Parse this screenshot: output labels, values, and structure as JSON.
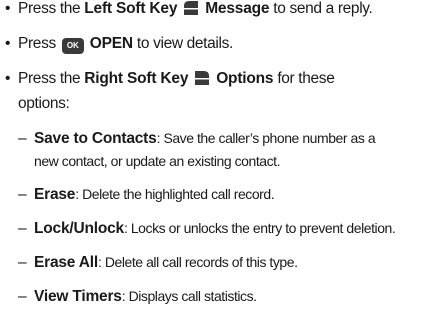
{
  "bullets": [
    {
      "prefix": "Press the ",
      "bold1": "Left Soft Key",
      "icon": "left-soft-key-icon",
      "bold2": "Message",
      "suffix": " to send a reply."
    },
    {
      "prefix": "Press ",
      "icon": "ok-key-icon",
      "icon_label": "OK",
      "bold1": "OPEN",
      "suffix": " to view details."
    },
    {
      "prefix": "Press the ",
      "bold1": "Right Soft Key",
      "icon": "right-soft-key-icon",
      "bold2": "Options",
      "suffix": " for these",
      "continuation": "options:"
    }
  ],
  "options": [
    {
      "term": "Save to Contacts",
      "desc": ": Save the caller’s phone number as a",
      "continuation": "new contact, or update an existing contact."
    },
    {
      "term": "Erase",
      "desc": ": Delete the highlighted call record."
    },
    {
      "term": "Lock/Unlock",
      "desc": ": Locks or unlocks the entry to prevent deletion."
    },
    {
      "term": "Erase All",
      "desc": ": Delete all call records of this type."
    },
    {
      "term": "View Timers",
      "desc": ": Displays call statistics."
    }
  ],
  "symbols": {
    "bullet": "•",
    "dash": "–"
  },
  "colors": {
    "text": "#1a1a1a",
    "icon": "#3a3a3a"
  }
}
